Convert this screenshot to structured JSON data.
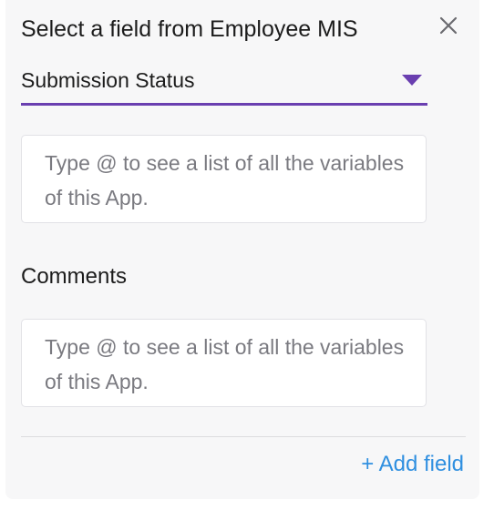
{
  "header": {
    "title": "Select a field from Employee MIS",
    "close_icon": "close-icon"
  },
  "field_select": {
    "selected_value": "Submission Status",
    "accent_color": "#6a3fb0",
    "arrow_icon": "caret-down-icon"
  },
  "value_input": {
    "placeholder": "Type @ to see a list of all the variables of this App.",
    "value": ""
  },
  "comments": {
    "label": "Comments",
    "placeholder": "Type @ to see a list of all the variables of this App.",
    "value": ""
  },
  "footer": {
    "add_field_label": "+ Add field",
    "link_color": "#2f8fe0"
  }
}
